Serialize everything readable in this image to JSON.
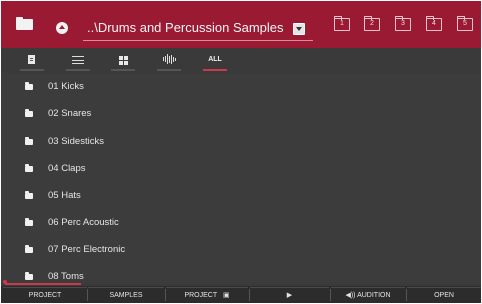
{
  "header": {
    "path": "..\\Drums and Percussion Samples",
    "favorites": [
      "1",
      "2",
      "3",
      "4",
      "5"
    ]
  },
  "filters": [
    {
      "id": "file",
      "label": ""
    },
    {
      "id": "list",
      "label": ""
    },
    {
      "id": "grid",
      "label": ""
    },
    {
      "id": "audio",
      "label": ""
    },
    {
      "id": "all",
      "label": "ALL",
      "active": true
    }
  ],
  "folders": [
    {
      "name": "01 Kicks"
    },
    {
      "name": "02 Snares"
    },
    {
      "name": "03 Sidesticks"
    },
    {
      "name": "04 Claps"
    },
    {
      "name": "05 Hats"
    },
    {
      "name": "06 Perc Acoustic"
    },
    {
      "name": "07 Perc Electronic"
    },
    {
      "name": "08 Toms"
    }
  ],
  "bottom": {
    "project": "PROJECT",
    "samples": "SAMPLES",
    "project_load": "PROJECT",
    "play_glyph": "▶",
    "audition": "AUDITION",
    "audition_glyph": "◀))",
    "open": "OPEN"
  },
  "colors": {
    "accent": "#9b1a33",
    "highlight": "#c83a4e",
    "background": "#3a3a3a"
  }
}
